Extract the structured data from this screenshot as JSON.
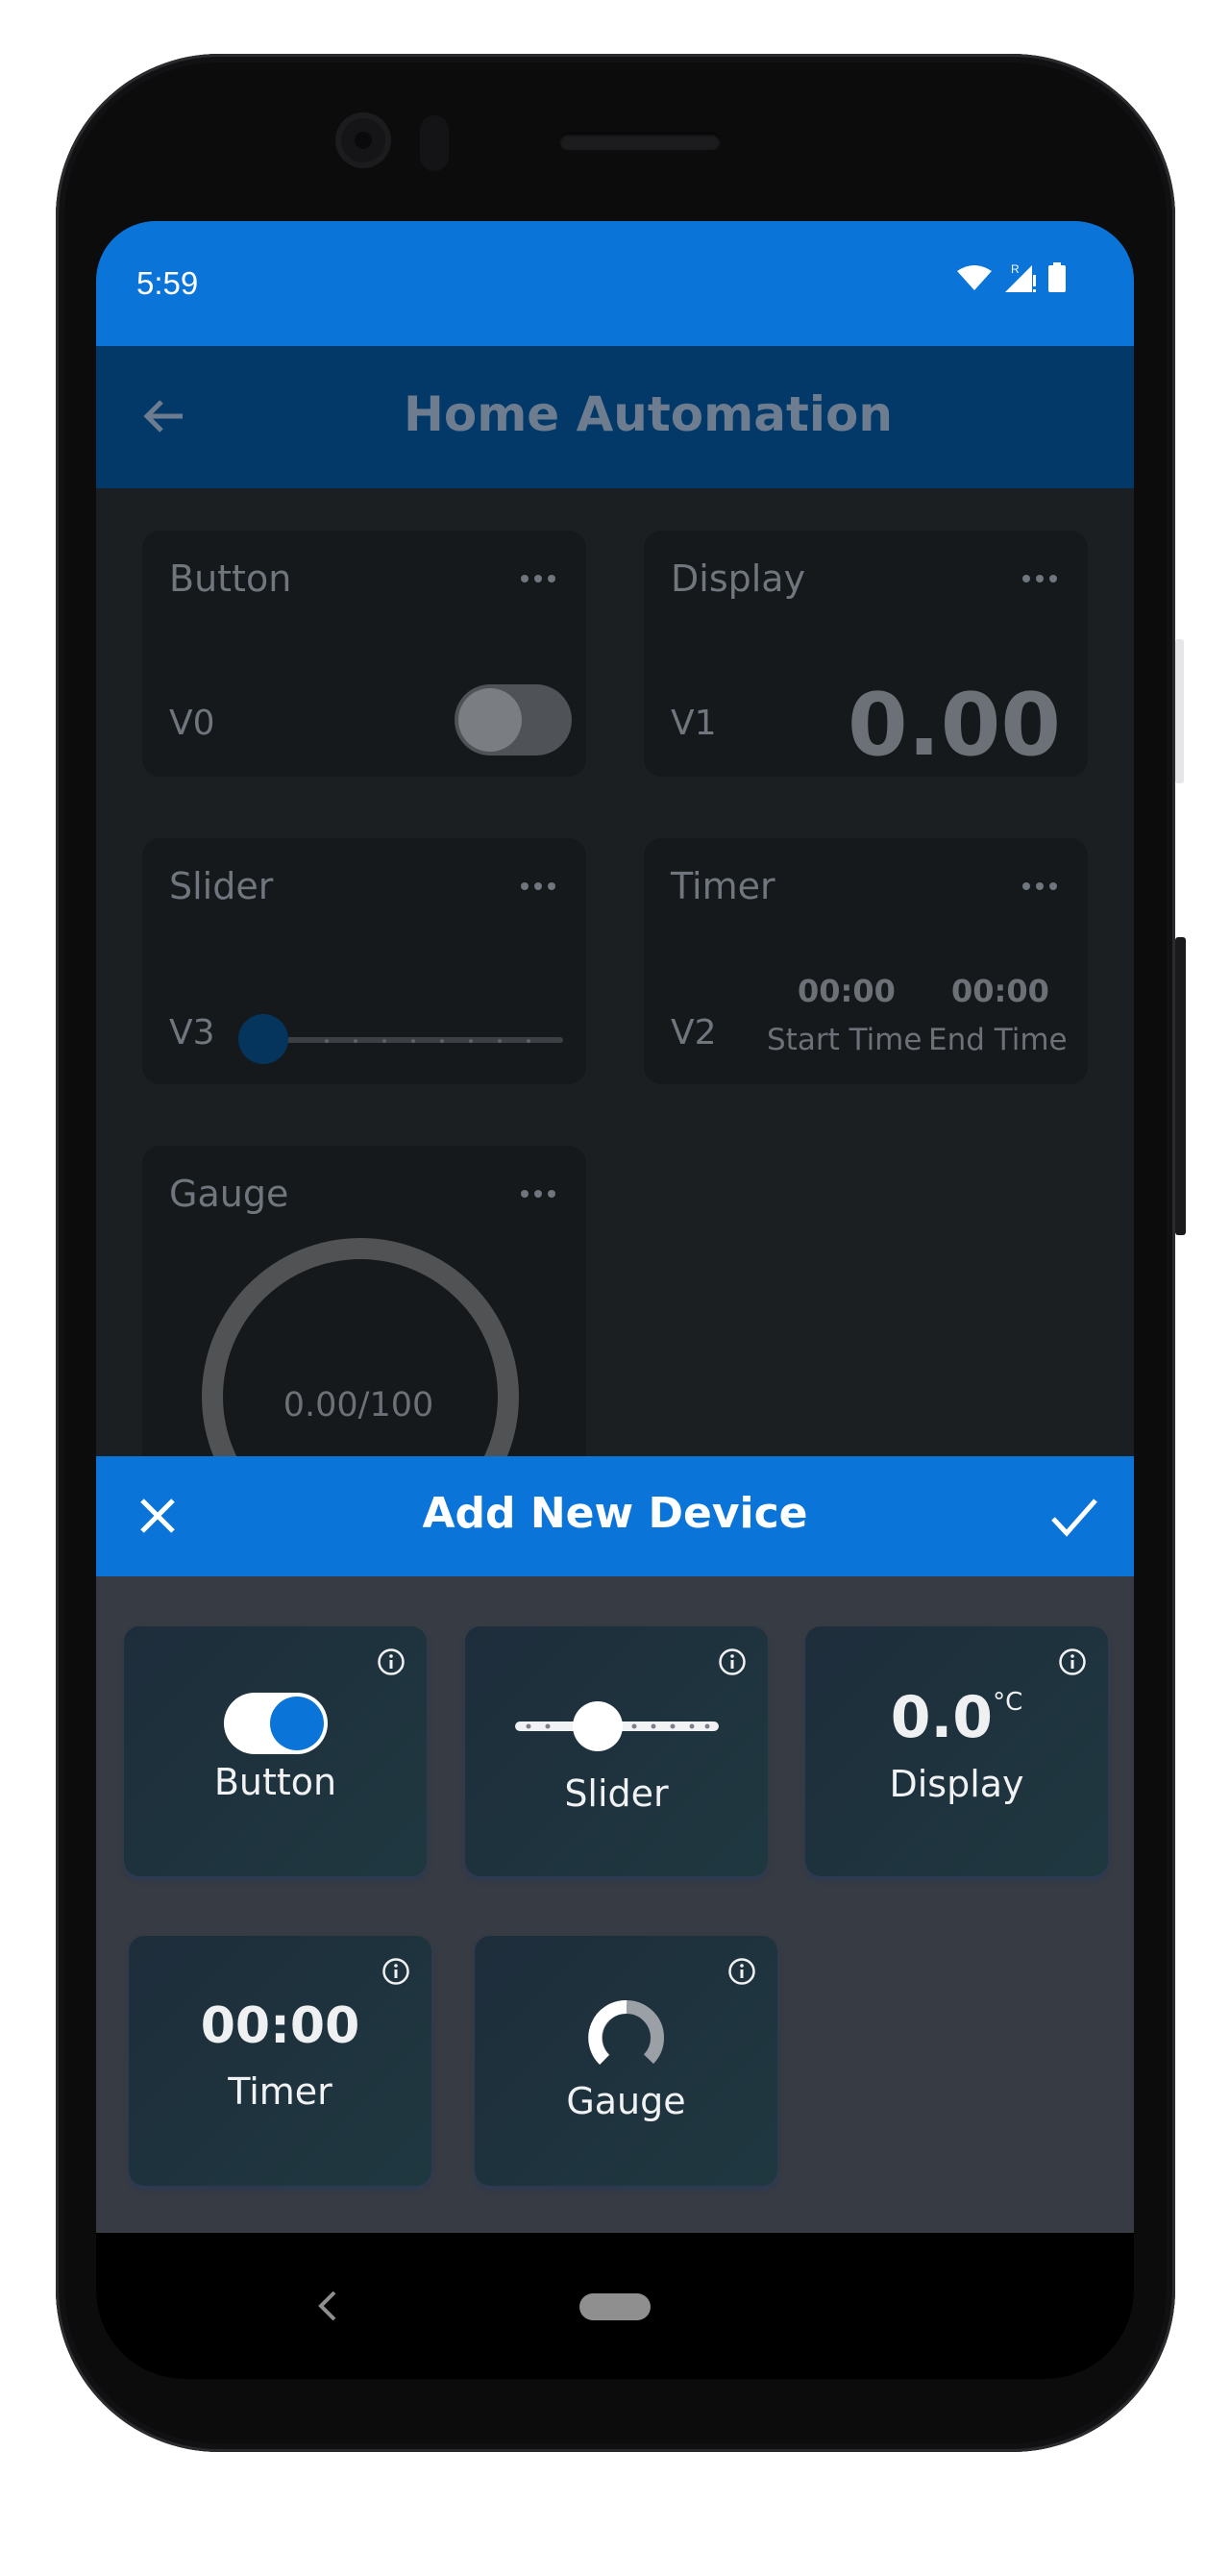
{
  "status_bar": {
    "time": "5:59",
    "roaming": "R"
  },
  "app_bar": {
    "title": "Home Automation"
  },
  "dashboard": {
    "button_card": {
      "title": "Button",
      "pin": "V0"
    },
    "display_card": {
      "title": "Display",
      "pin": "V1",
      "value": "0.00"
    },
    "slider_card": {
      "title": "Slider",
      "pin": "V3",
      "level": 0
    },
    "timer_card": {
      "title": "Timer",
      "pin": "V2",
      "start_value": "00:00",
      "end_value": "00:00",
      "start_label": "Start Time",
      "end_label": "End Time"
    },
    "gauge_card": {
      "title": "Gauge",
      "value_text": "0.00/100"
    }
  },
  "add_device_sheet": {
    "title": "Add New Device",
    "tiles": {
      "button": {
        "label": "Button"
      },
      "slider": {
        "label": "Slider"
      },
      "display": {
        "label": "Display",
        "value": "0.0",
        "unit": "°C"
      },
      "timer": {
        "label": "Timer",
        "value": "00:00"
      },
      "gauge": {
        "label": "Gauge"
      }
    }
  },
  "colors": {
    "accent": "#0a74d8",
    "appbar": "#033969",
    "sheet_bg": "#373b43"
  }
}
